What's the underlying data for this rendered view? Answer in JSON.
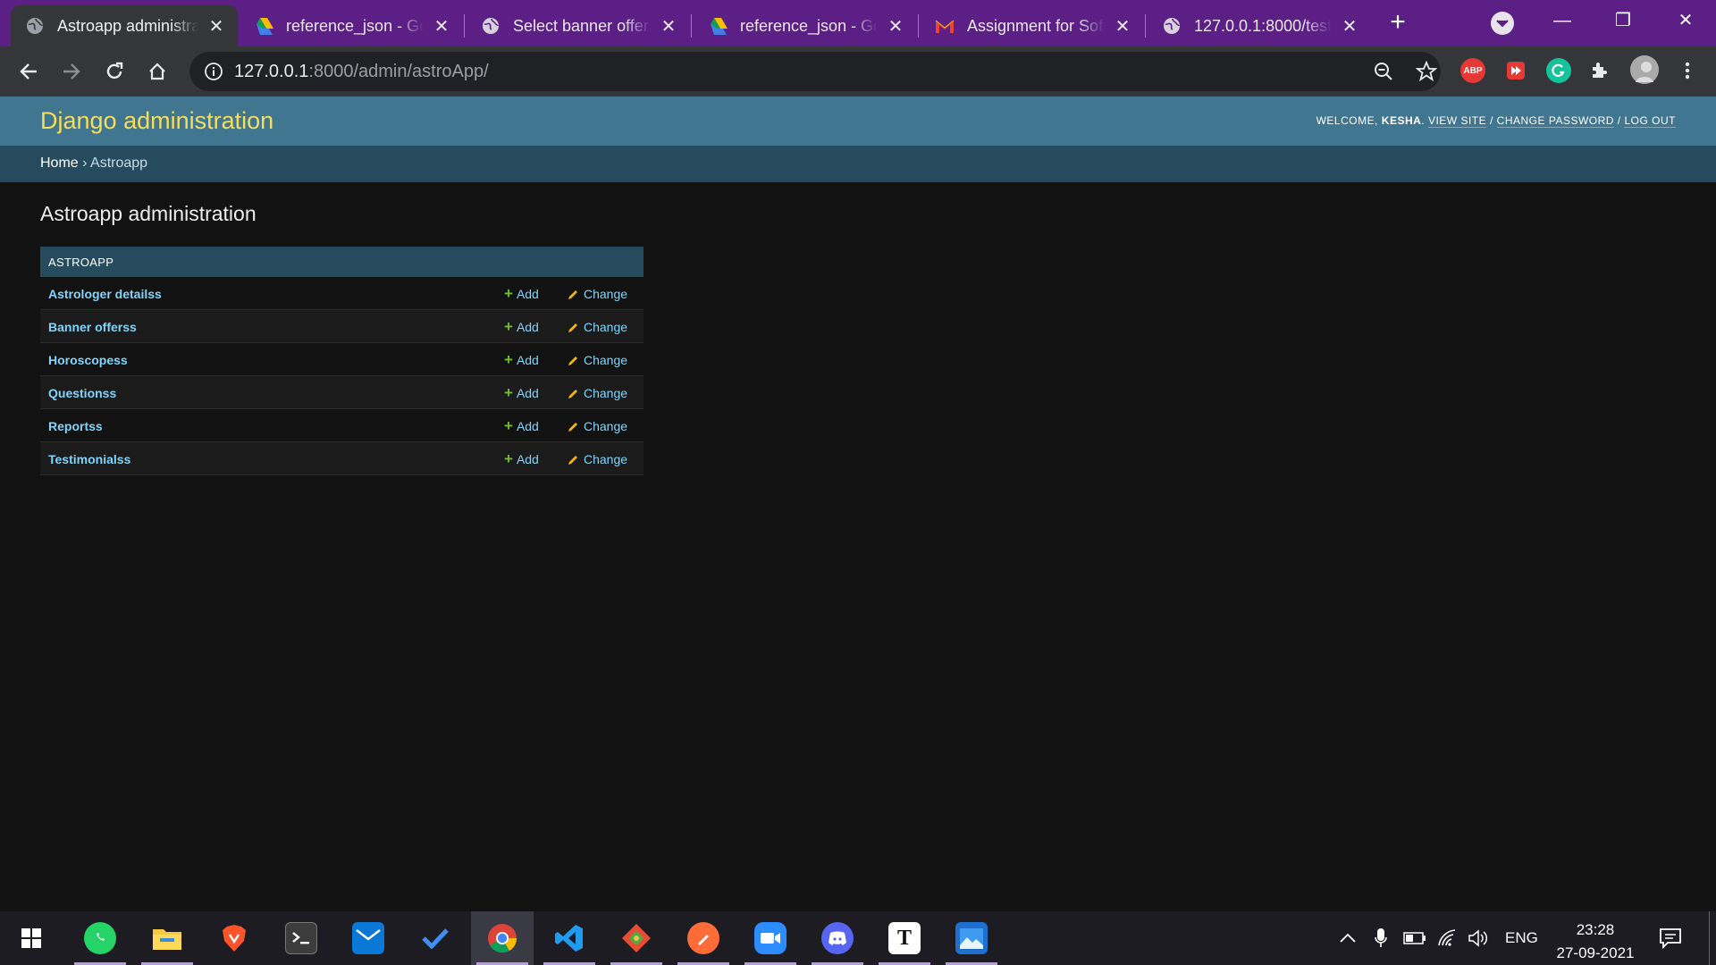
{
  "browser": {
    "tabs": [
      {
        "title": "Astroapp administra",
        "icon": "globe-icon",
        "active": true
      },
      {
        "title": "reference_json - Go",
        "icon": "google-drive-icon",
        "active": false
      },
      {
        "title": "Select banner offers",
        "icon": "globe-icon",
        "active": false
      },
      {
        "title": "reference_json - Go",
        "icon": "google-drive-icon",
        "active": false
      },
      {
        "title": "Assignment for Soft",
        "icon": "gmail-icon",
        "active": false
      },
      {
        "title": "127.0.0.1:8000/testi",
        "icon": "globe-icon",
        "active": false
      }
    ],
    "address": {
      "host": "127.0.0.1",
      "rest": ":8000/admin/astroApp/"
    },
    "extensions": {
      "abp_label": "ABP"
    }
  },
  "django": {
    "site_name": "Django administration",
    "user_tools": {
      "welcome": "WELCOME,",
      "username": "KESHA",
      "view_site": "VIEW SITE",
      "change_password": "CHANGE PASSWORD",
      "log_out": "LOG OUT",
      "separator": " / "
    },
    "breadcrumbs": {
      "home": "Home",
      "sep": " › ",
      "current": "Astroapp"
    },
    "page_title": "Astroapp administration",
    "module": {
      "caption": "ASTROAPP",
      "add_label": "Add",
      "change_label": "Change",
      "models": [
        "Astrologer detailss",
        "Banner offerss",
        "Horoscopess",
        "Questionss",
        "Reportss",
        "Testimonialss"
      ]
    }
  },
  "taskbar": {
    "apps": [
      "whatsapp",
      "file-explorer",
      "brave",
      "terminal",
      "mail",
      "todo",
      "chrome",
      "vscode",
      "git",
      "postman",
      "zoom",
      "discord",
      "typora",
      "photos"
    ],
    "tray": {
      "language": "ENG",
      "time": "23:28",
      "date": "27-09-2021"
    }
  },
  "colors": {
    "header_bg": "#417690",
    "site_name": "#f5dd5d",
    "breadcrumbs_bg": "#264b5d",
    "link": "#81d4fa",
    "add_icon": "#70bf2b",
    "change_icon": "#efb80b",
    "tabstrip": "#5b1f86"
  }
}
